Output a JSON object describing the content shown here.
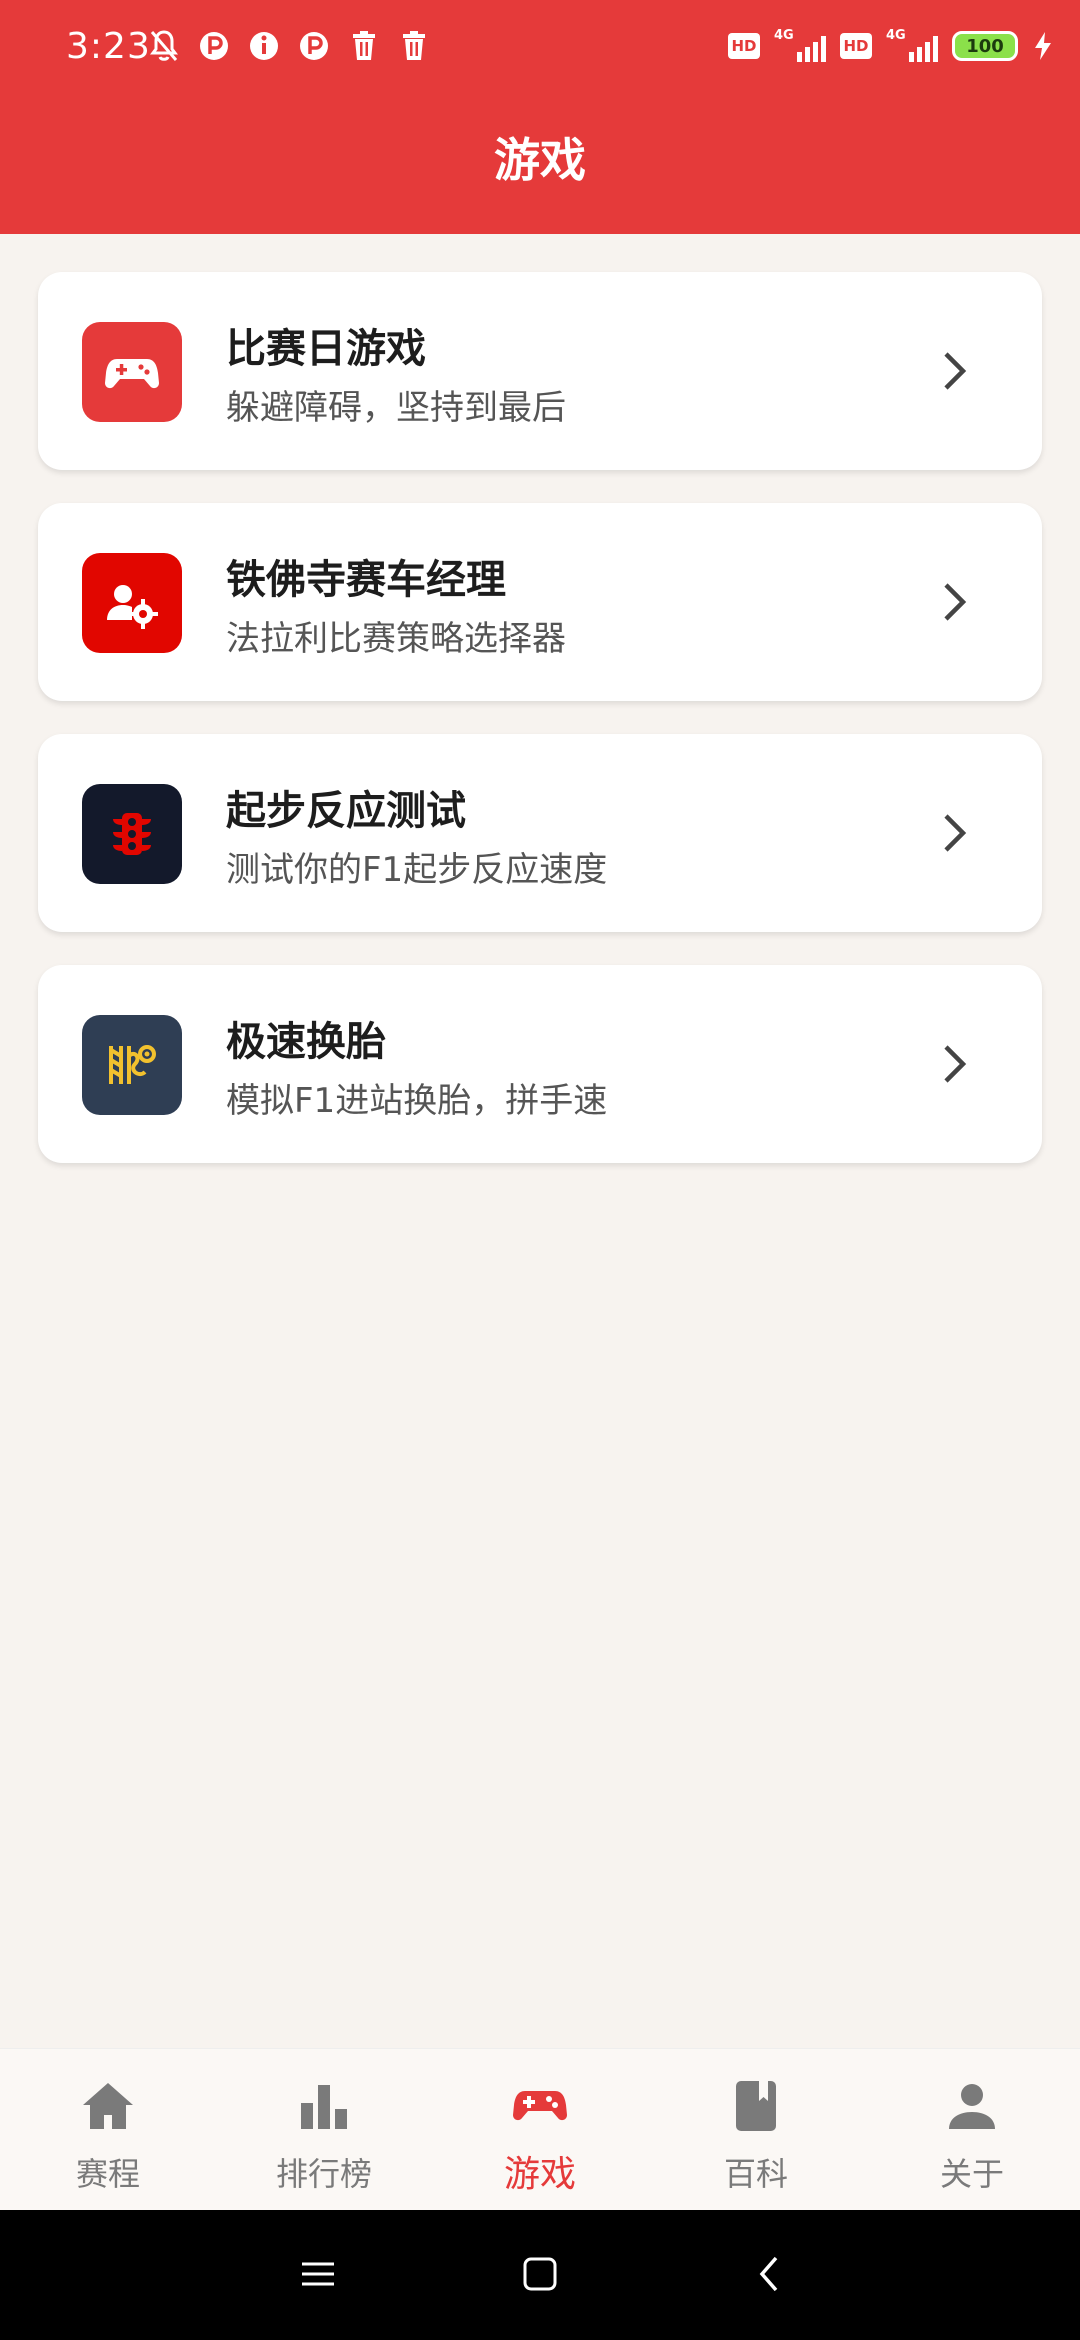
{
  "status_bar": {
    "time": "3:23",
    "network_label": "4G",
    "hd_label": "HD",
    "battery": "100"
  },
  "header": {
    "title": "游戏"
  },
  "games": [
    {
      "title": "比赛日游戏",
      "subtitle": "躲避障碍，坚持到最后",
      "icon": "gamepad-icon",
      "icon_bg": "#e53a3a"
    },
    {
      "title": "铁佛寺赛车经理",
      "subtitle": "法拉利比赛策略选择器",
      "icon": "manager-gear-icon",
      "icon_bg": "#e10600"
    },
    {
      "title": "起步反应测试",
      "subtitle": "测试你的F1起步反应速度",
      "icon": "traffic-light-icon",
      "icon_bg": "#13192b"
    },
    {
      "title": "极速换胎",
      "subtitle": "模拟F1进站换胎，拼手速",
      "icon": "tire-change-icon",
      "icon_bg": "#2f3e54"
    }
  ],
  "bottom_nav": [
    {
      "label": "赛程",
      "icon": "home-icon",
      "active": false
    },
    {
      "label": "排行榜",
      "icon": "bar-chart-icon",
      "active": false
    },
    {
      "label": "游戏",
      "icon": "gamepad-icon",
      "active": true
    },
    {
      "label": "百科",
      "icon": "book-icon",
      "active": false
    },
    {
      "label": "关于",
      "icon": "person-icon",
      "active": false
    }
  ],
  "colors": {
    "primary": "#e53a3a",
    "background": "#f7f3ef",
    "inactive": "#7a7a7a"
  }
}
